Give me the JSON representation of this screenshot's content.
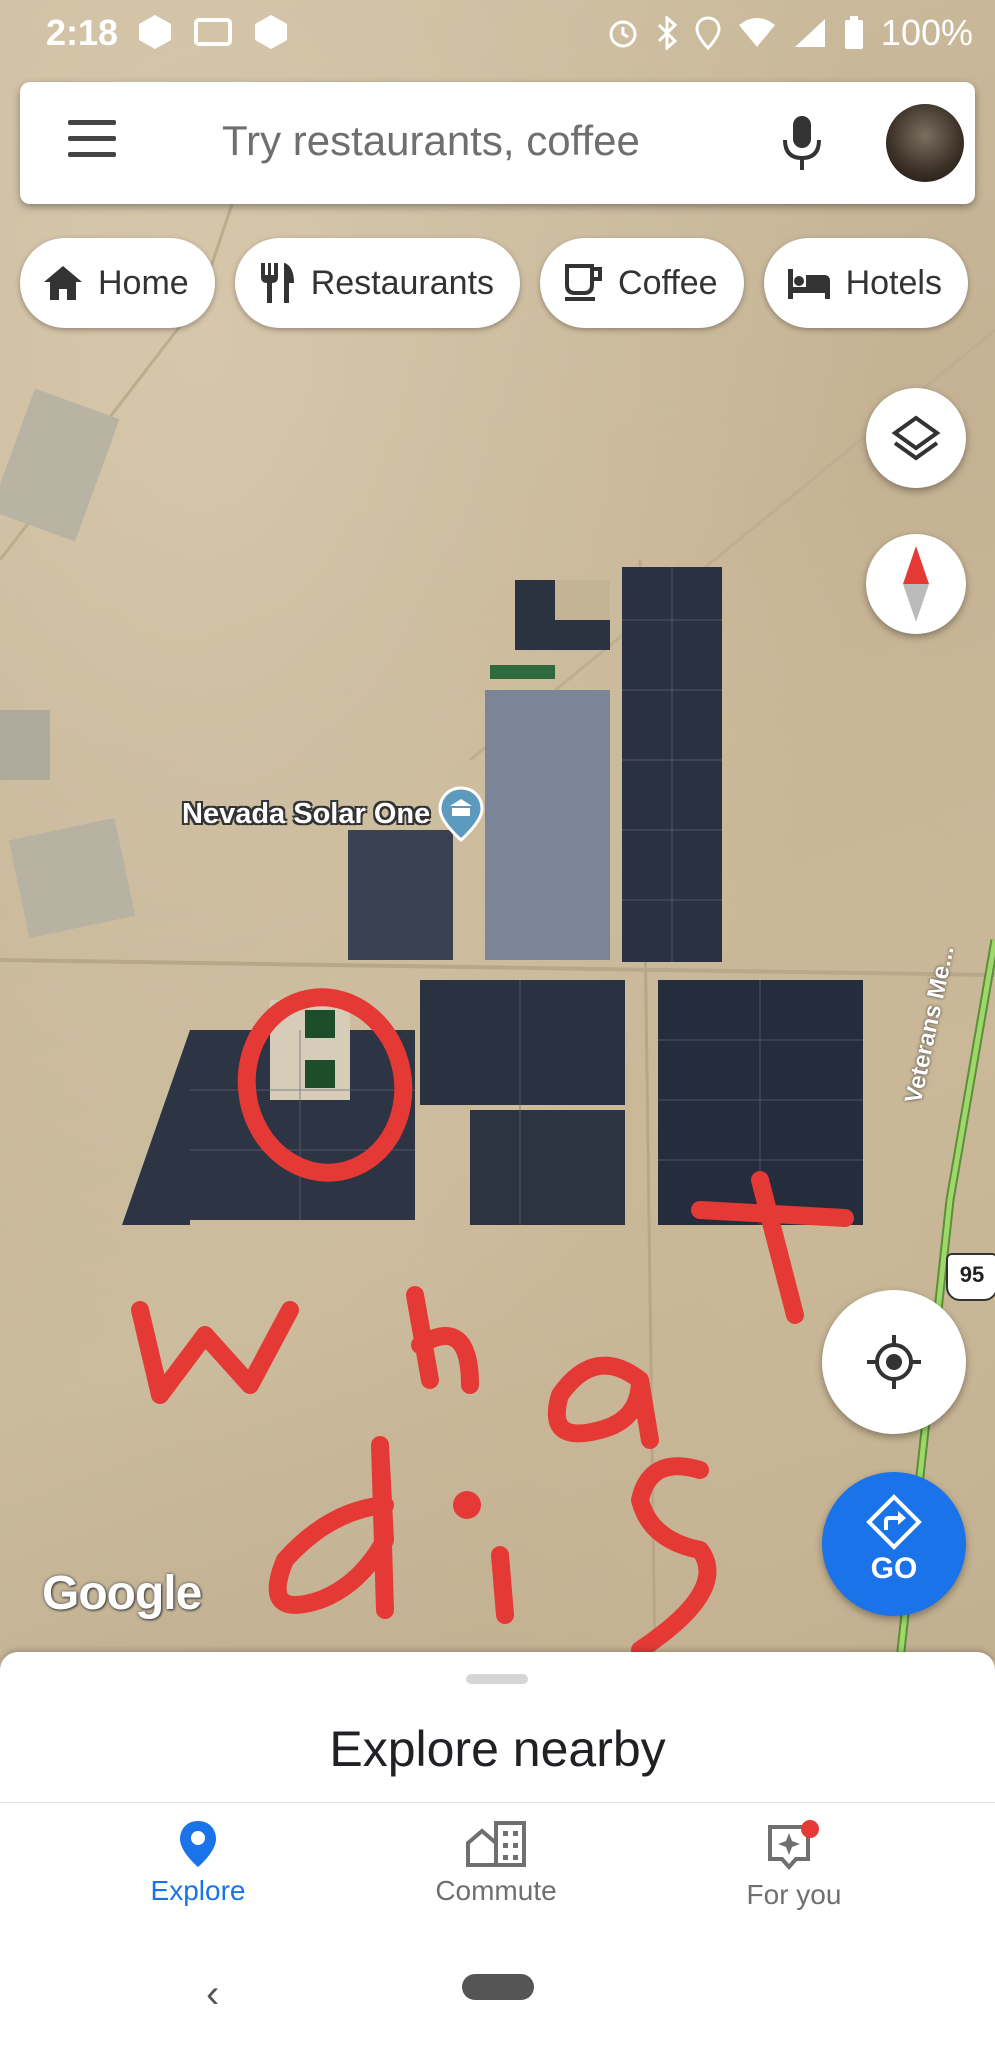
{
  "status": {
    "time": "2:18",
    "battery": "100%"
  },
  "search": {
    "placeholder": "Try restaurants, coffee"
  },
  "chips": [
    {
      "label": "Home",
      "icon": "home-icon"
    },
    {
      "label": "Restaurants",
      "icon": "fork-knife-icon"
    },
    {
      "label": "Coffee",
      "icon": "coffee-cup-icon"
    },
    {
      "label": "Hotels",
      "icon": "bed-icon"
    }
  ],
  "map": {
    "poi_label": "Nevada Solar One",
    "road_label": "Veterans Me...",
    "route_shield": "95",
    "google_logo": "Google",
    "annotation_text": "what dis"
  },
  "go_button": {
    "label": "GO"
  },
  "sheet": {
    "title": "Explore nearby"
  },
  "nav": [
    {
      "label": "Explore",
      "active": true
    },
    {
      "label": "Commute",
      "active": false
    },
    {
      "label": "For you",
      "active": false
    }
  ],
  "colors": {
    "accent": "#1a73e8",
    "annotation": "#e53935"
  }
}
